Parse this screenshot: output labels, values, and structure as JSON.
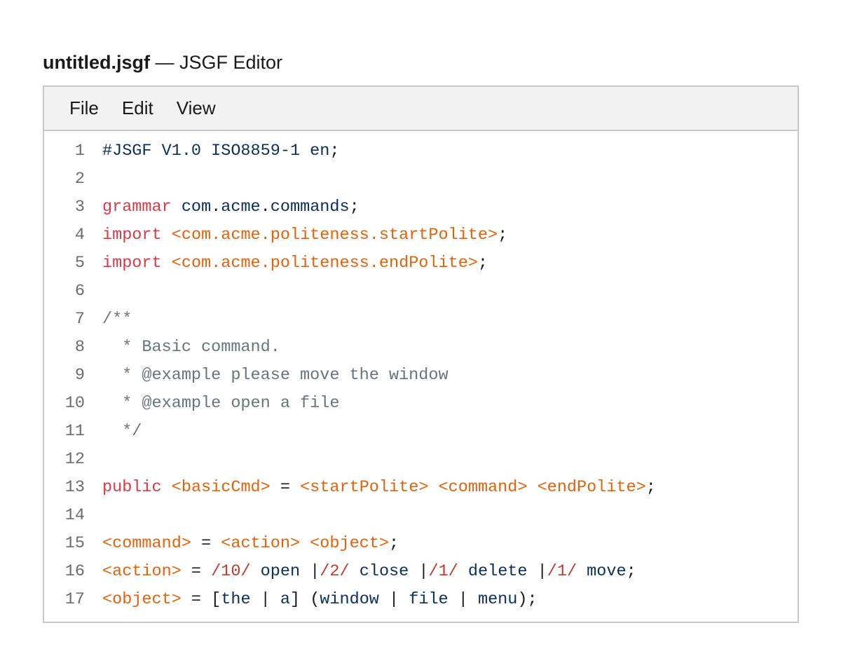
{
  "title": {
    "filename": "untitled.jsgf",
    "suffix": " — JSGF Editor"
  },
  "menu": [
    "File",
    "Edit",
    "View"
  ],
  "colors": {
    "keyword": "#d73a49",
    "rule_reference": "#e36209",
    "token": "#0b2e5b",
    "comment": "#6a737d",
    "weight": "#c0392b"
  },
  "editor": {
    "lines": [
      [
        {
          "c": "t",
          "s": "#JSGF V1.0 ISO8859-1 en"
        },
        {
          "c": "p",
          "s": ";"
        }
      ],
      [],
      [
        {
          "c": "k",
          "s": "grammar"
        },
        {
          "c": "p",
          "s": " "
        },
        {
          "c": "t",
          "s": "com"
        },
        {
          "c": "p",
          "s": "."
        },
        {
          "c": "t",
          "s": "acme"
        },
        {
          "c": "p",
          "s": "."
        },
        {
          "c": "t",
          "s": "commands"
        },
        {
          "c": "p",
          "s": ";"
        }
      ],
      [
        {
          "c": "k",
          "s": "import"
        },
        {
          "c": "p",
          "s": " "
        },
        {
          "c": "r",
          "s": "<com.acme.politeness.startPolite>"
        },
        {
          "c": "p",
          "s": ";"
        }
      ],
      [
        {
          "c": "k",
          "s": "import"
        },
        {
          "c": "p",
          "s": " "
        },
        {
          "c": "r",
          "s": "<com.acme.politeness.endPolite>"
        },
        {
          "c": "p",
          "s": ";"
        }
      ],
      [],
      [
        {
          "c": "c",
          "s": "/**"
        }
      ],
      [
        {
          "c": "c",
          "s": "  * Basic command."
        }
      ],
      [
        {
          "c": "c",
          "s": "  * @example please move the window"
        }
      ],
      [
        {
          "c": "c",
          "s": "  * @example open a file"
        }
      ],
      [
        {
          "c": "c",
          "s": "  */"
        }
      ],
      [],
      [
        {
          "c": "k",
          "s": "public"
        },
        {
          "c": "p",
          "s": " "
        },
        {
          "c": "r",
          "s": "<basicCmd>"
        },
        {
          "c": "p",
          "s": " = "
        },
        {
          "c": "r",
          "s": "<startPolite>"
        },
        {
          "c": "p",
          "s": " "
        },
        {
          "c": "r",
          "s": "<command>"
        },
        {
          "c": "p",
          "s": " "
        },
        {
          "c": "r",
          "s": "<endPolite>"
        },
        {
          "c": "p",
          "s": ";"
        }
      ],
      [],
      [
        {
          "c": "r",
          "s": "<command>"
        },
        {
          "c": "p",
          "s": " = "
        },
        {
          "c": "r",
          "s": "<action>"
        },
        {
          "c": "p",
          "s": " "
        },
        {
          "c": "r",
          "s": "<object>"
        },
        {
          "c": "p",
          "s": ";"
        }
      ],
      [
        {
          "c": "r",
          "s": "<action>"
        },
        {
          "c": "p",
          "s": " = "
        },
        {
          "c": "w",
          "s": "/10/"
        },
        {
          "c": "p",
          "s": " "
        },
        {
          "c": "t",
          "s": "open"
        },
        {
          "c": "p",
          "s": " |"
        },
        {
          "c": "w",
          "s": "/2/"
        },
        {
          "c": "p",
          "s": " "
        },
        {
          "c": "t",
          "s": "close"
        },
        {
          "c": "p",
          "s": " |"
        },
        {
          "c": "w",
          "s": "/1/"
        },
        {
          "c": "p",
          "s": " "
        },
        {
          "c": "t",
          "s": "delete"
        },
        {
          "c": "p",
          "s": " |"
        },
        {
          "c": "w",
          "s": "/1/"
        },
        {
          "c": "p",
          "s": " "
        },
        {
          "c": "t",
          "s": "move"
        },
        {
          "c": "p",
          "s": ";"
        }
      ],
      [
        {
          "c": "r",
          "s": "<object>"
        },
        {
          "c": "p",
          "s": " = ["
        },
        {
          "c": "t",
          "s": "the"
        },
        {
          "c": "p",
          "s": " | "
        },
        {
          "c": "t",
          "s": "a"
        },
        {
          "c": "p",
          "s": "] ("
        },
        {
          "c": "t",
          "s": "window"
        },
        {
          "c": "p",
          "s": " | "
        },
        {
          "c": "t",
          "s": "file"
        },
        {
          "c": "p",
          "s": " | "
        },
        {
          "c": "t",
          "s": "menu"
        },
        {
          "c": "p",
          "s": ");"
        }
      ]
    ]
  }
}
